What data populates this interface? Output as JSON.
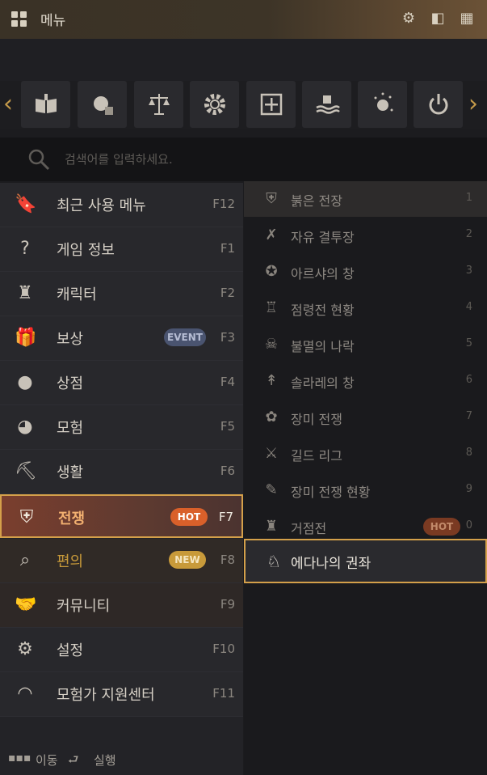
{
  "window": {
    "title": "메뉴"
  },
  "quick_icons": [
    {
      "name": "book-icon"
    },
    {
      "name": "shop-icon"
    },
    {
      "name": "scale-icon"
    },
    {
      "name": "gear-icon"
    },
    {
      "name": "plus-box-icon"
    },
    {
      "name": "water-hand-icon"
    },
    {
      "name": "sparkle-orb-icon"
    },
    {
      "name": "power-icon"
    }
  ],
  "search": {
    "placeholder": "검색어를 입력하세요."
  },
  "left_menu": [
    {
      "label": "최근 사용 메뉴",
      "key": "F12",
      "icon": "bookmark-icon"
    },
    {
      "label": "게임 정보",
      "key": "F1",
      "icon": "question-icon"
    },
    {
      "label": "캐릭터",
      "key": "F2",
      "icon": "helmet-icon"
    },
    {
      "label": "보상",
      "key": "F3",
      "icon": "gift-icon",
      "badge": "EVENT"
    },
    {
      "label": "상점",
      "key": "F4",
      "icon": "shop-icon"
    },
    {
      "label": "모험",
      "key": "F5",
      "icon": "map-icon"
    },
    {
      "label": "생활",
      "key": "F6",
      "icon": "pickaxe-icon"
    },
    {
      "label": "전쟁",
      "key": "F7",
      "icon": "sword-shield-icon",
      "badge": "HOT",
      "active": true
    },
    {
      "label": "편의",
      "key": "F8",
      "icon": "search-icon",
      "badge": "NEW"
    },
    {
      "label": "커뮤니티",
      "key": "F9",
      "icon": "handshake-icon"
    },
    {
      "label": "설정",
      "key": "F10",
      "icon": "gear-icon"
    },
    {
      "label": "모험가 지원센터",
      "key": "F11",
      "icon": "headset-icon"
    }
  ],
  "right_menu": [
    {
      "label": "붉은 전장",
      "num": "1",
      "icon": "sword-shield-icon"
    },
    {
      "label": "자유 결투장",
      "num": "2",
      "icon": "crossed-axes-icon"
    },
    {
      "label": "아르샤의 창",
      "num": "3",
      "icon": "emblem-icon"
    },
    {
      "label": "점령전 현황",
      "num": "4",
      "icon": "castle-icon"
    },
    {
      "label": "불멸의 나락",
      "num": "5",
      "icon": "skull-icon"
    },
    {
      "label": "솔라레의 창",
      "num": "6",
      "icon": "spear-icon"
    },
    {
      "label": "장미 전쟁",
      "num": "7",
      "icon": "rose-icon"
    },
    {
      "label": "길드 리그",
      "num": "8",
      "icon": "swords-icon"
    },
    {
      "label": "장미 전쟁 현황",
      "num": "9",
      "icon": "scroll-icon"
    },
    {
      "label": "거점전",
      "num": "0",
      "icon": "tower-icon",
      "badge": "HOT"
    }
  ],
  "right_selected": {
    "label": "에다나의 권좌",
    "icon": "edana-icon"
  },
  "footer": {
    "move_label": "이동",
    "run_label": "실행"
  },
  "colors": {
    "accent": "#d4a04a",
    "hot": "#d9602a",
    "new": "#c89a3a",
    "event": "#4a5470"
  }
}
